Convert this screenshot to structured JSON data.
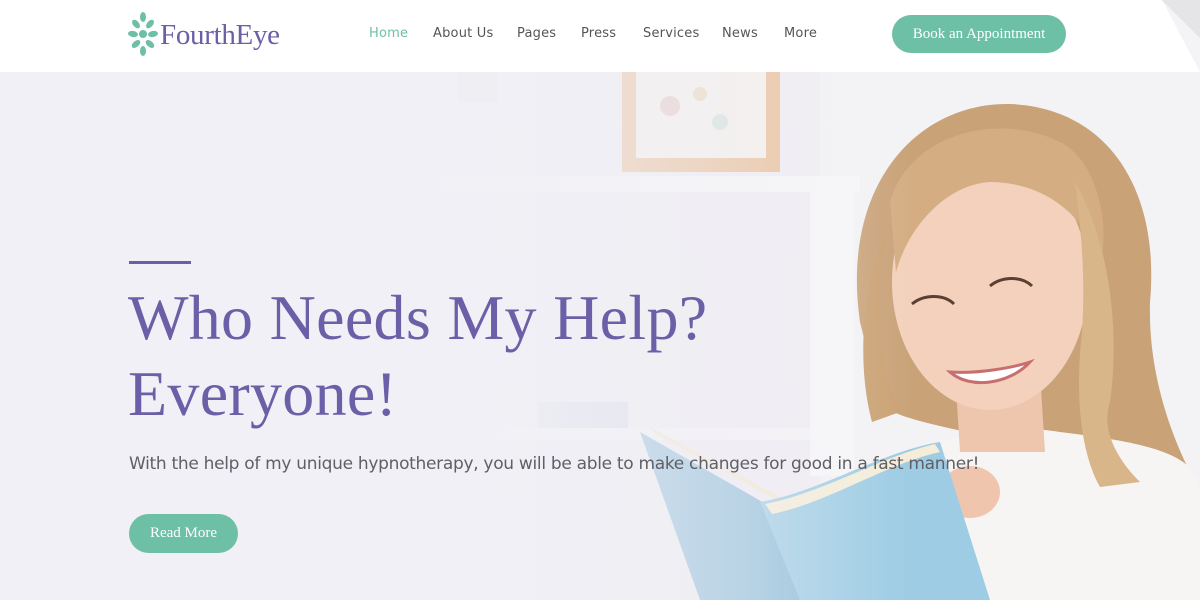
{
  "brand": {
    "name": "FourthEye"
  },
  "nav": {
    "items": [
      {
        "label": "Home",
        "active": true
      },
      {
        "label": "About Us",
        "active": false
      },
      {
        "label": "Pages",
        "active": false
      },
      {
        "label": "Press",
        "active": false
      },
      {
        "label": "Services",
        "active": false
      },
      {
        "label": "News",
        "active": false
      },
      {
        "label": "More",
        "active": false
      }
    ],
    "cta_label": "Book an Appointment"
  },
  "hero": {
    "headline_line1": "Who Needs My Help?",
    "headline_line2": "Everyone!",
    "subtext": "With the help of my unique hypnotherapy, you will be able to make changes for good in a fast manner!",
    "button_label": "Read More",
    "image": "woman-reading-book"
  },
  "colors": {
    "accent_green": "#6dbfa6",
    "brand_purple": "#6c5fa7",
    "text_gray": "#5f5f66",
    "nav_gray": "#555555"
  },
  "icons": {
    "logo": "leaf-cluster-icon"
  }
}
